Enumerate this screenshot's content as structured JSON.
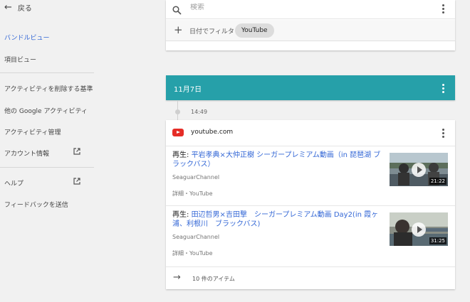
{
  "sidebar": {
    "back_label": "戻る",
    "items": [
      {
        "label": "バンドルビュー"
      },
      {
        "label": "項目ビュー"
      },
      {
        "label": "アクティビティを削除する基準"
      },
      {
        "label": "他の Google アクティビティ"
      },
      {
        "label": "アクティビティ管理"
      },
      {
        "label": "アカウント情報"
      },
      {
        "label": "ヘルプ"
      },
      {
        "label": "フィードバックを送信"
      }
    ]
  },
  "search": {
    "placeholder": "検索",
    "filter_label": "日付でフィルタ",
    "chip": "YouTube"
  },
  "date_header": "11月7日",
  "time": "14:49",
  "site": "youtube.com",
  "entries": [
    {
      "prefix": "再生: ",
      "title": "平岩孝典×大仲正樹 シーガープレミアム動画（in 琵琶湖 ブラックバス）",
      "channel": "SeaguarChannel",
      "meta": "詳細・YouTube",
      "duration": "21:22"
    },
    {
      "prefix": "再生: ",
      "title": "田辺哲男×吉田撃　シーガープレミアム動画 Day2(in 霞ヶ浦、利根川　ブラックバス)",
      "channel": "SeaguarChannel",
      "meta": "詳細・YouTube",
      "duration": "31:25"
    }
  ],
  "more_label": "10 件のアイテム",
  "colors": {
    "accent": "#3367d6",
    "date_bar": "#26a0a9",
    "youtube_red": "#e52d27",
    "background": "#f1f1f1"
  }
}
